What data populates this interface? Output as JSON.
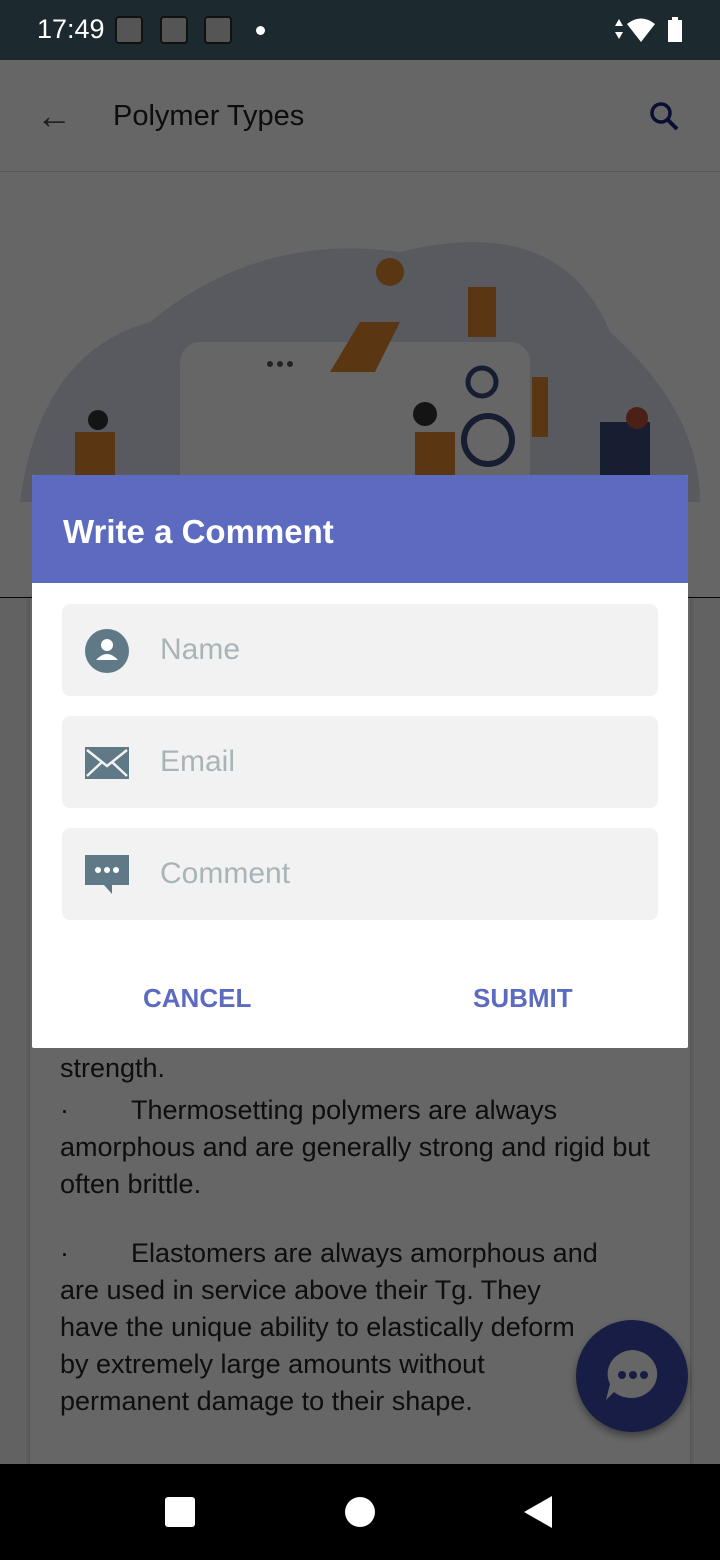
{
  "status_bar": {
    "time": "17:49"
  },
  "app_bar": {
    "title": "Polymer Types",
    "back_icon": "arrow-left-icon",
    "search_icon": "search-icon"
  },
  "content": {
    "partial_line": "strength.",
    "paragraphs": [
      {
        "bullet": "·",
        "text": "Thermosetting polymers are always amorphous and are generally strong and rigid but often brittle."
      },
      {
        "bullet": "·",
        "text": "Elastomers are always amorphous and are used in service above their Tg. They have the unique ability to elastically deform by extremely large amounts without permanent damage to their shape."
      }
    ]
  },
  "dialog": {
    "title": "Write a Comment",
    "fields": [
      {
        "icon": "person-icon",
        "placeholder": "Name",
        "value": ""
      },
      {
        "icon": "envelope-icon",
        "placeholder": "Email",
        "value": ""
      },
      {
        "icon": "comment-icon",
        "placeholder": "Comment",
        "value": ""
      }
    ],
    "cancel_label": "CANCEL",
    "submit_label": "SUBMIT"
  },
  "colors": {
    "accent": "#5c6bc0",
    "status_bar": "#1c2a30",
    "fab": "#3949ab"
  }
}
